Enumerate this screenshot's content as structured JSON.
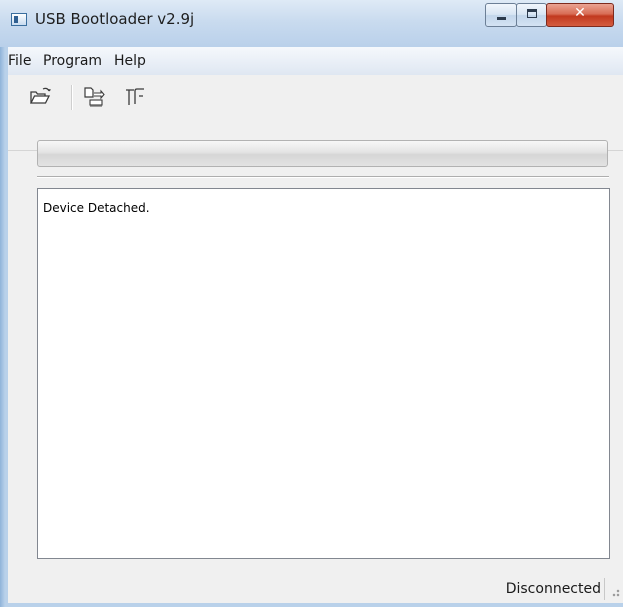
{
  "window": {
    "title": "USB Bootloader v2.9j",
    "buttons": {
      "minimize": "minimize-icon",
      "maximize": "maximize-icon",
      "close": "close-icon"
    }
  },
  "menu": {
    "items": [
      {
        "label": "File"
      },
      {
        "label": "Program"
      },
      {
        "label": "Help"
      }
    ]
  },
  "toolbar": {
    "buttons": [
      {
        "icon": "open-folder-icon"
      },
      {
        "icon": "program-device-icon"
      },
      {
        "icon": "reset-device-icon"
      }
    ]
  },
  "progress": {
    "value": 0
  },
  "log": {
    "lines": [
      "Device Detached."
    ]
  },
  "status": {
    "text": "Disconnected"
  },
  "colors": {
    "title_bar": "#c9dbef",
    "client_bg": "#f0f0f0",
    "close_button": "#c1391f"
  }
}
